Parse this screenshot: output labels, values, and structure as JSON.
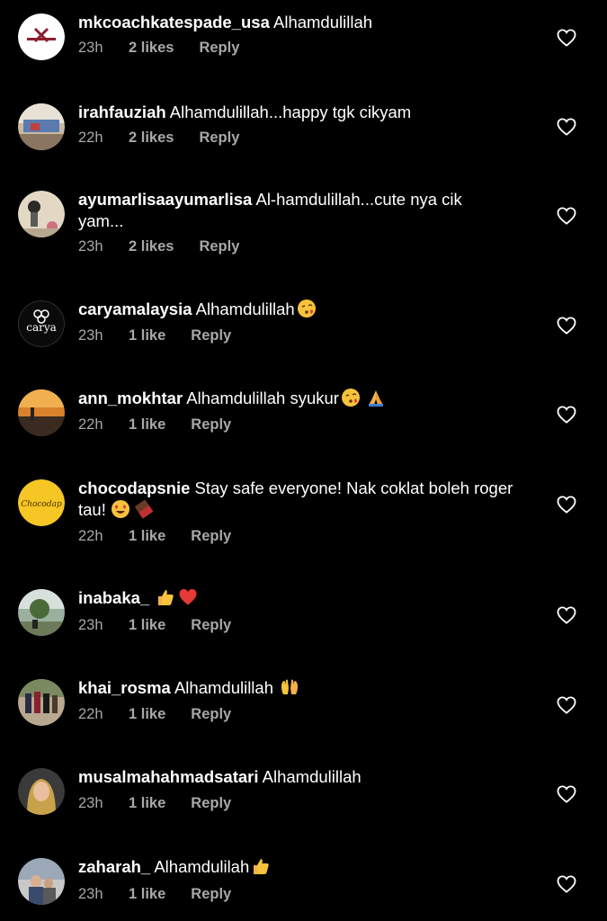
{
  "colors": {
    "background": "#000000",
    "text": "#ffffff",
    "meta_text": "#a8a8a8"
  },
  "comments": [
    {
      "username": "mkcoachkatespade_usa",
      "text": " Alhamdulillah",
      "time": "23h",
      "likes": "2 likes",
      "reply": "Reply",
      "emojis": []
    },
    {
      "username": "irahfauziah",
      "text": " Alhamdulillah...happy tgk cikyam",
      "time": "22h",
      "likes": "2 likes",
      "reply": "Reply",
      "emojis": []
    },
    {
      "username": "ayumarlisaayumarlisa",
      "text": " Al-hamdulillah...cute nya cik yam...",
      "time": "23h",
      "likes": "2 likes",
      "reply": "Reply",
      "emojis": []
    },
    {
      "username": "caryamalaysia",
      "text": " Alhamdulillah",
      "time": "23h",
      "likes": "1 like",
      "reply": "Reply",
      "emojis": [
        "kissing-heart-emoji"
      ]
    },
    {
      "username": "ann_mokhtar",
      "text": " Alhamdulillah syukur",
      "time": "22h",
      "likes": "1 like",
      "reply": "Reply",
      "emojis": [
        "kissing-heart-emoji",
        "praying-hands-emoji"
      ]
    },
    {
      "username": "chocodapsnie",
      "text": " Stay safe everyone! Nak coklat boleh roger tau!",
      "time": "22h",
      "likes": "1 like",
      "reply": "Reply",
      "emojis": [
        "heart-eyes-emoji",
        "chocolate-bar-emoji"
      ]
    },
    {
      "username": "inabaka_",
      "text": " ",
      "time": "23h",
      "likes": "1 like",
      "reply": "Reply",
      "emojis": [
        "thumbs-up-emoji",
        "red-heart-emoji"
      ]
    },
    {
      "username": "khai_rosma",
      "text": " Alhamdulillah ",
      "time": "22h",
      "likes": "1 like",
      "reply": "Reply",
      "emojis": [
        "open-hands-emoji"
      ]
    },
    {
      "username": "musalmahahmadsatari",
      "text": " Alhamdulillah",
      "time": "23h",
      "likes": "1 like",
      "reply": "Reply",
      "emojis": []
    },
    {
      "username": "zaharah_",
      "text": " Alhamdulilah",
      "time": "23h",
      "likes": "1 like",
      "reply": "Reply",
      "emojis": [
        "thumbs-up-emoji"
      ]
    }
  ]
}
